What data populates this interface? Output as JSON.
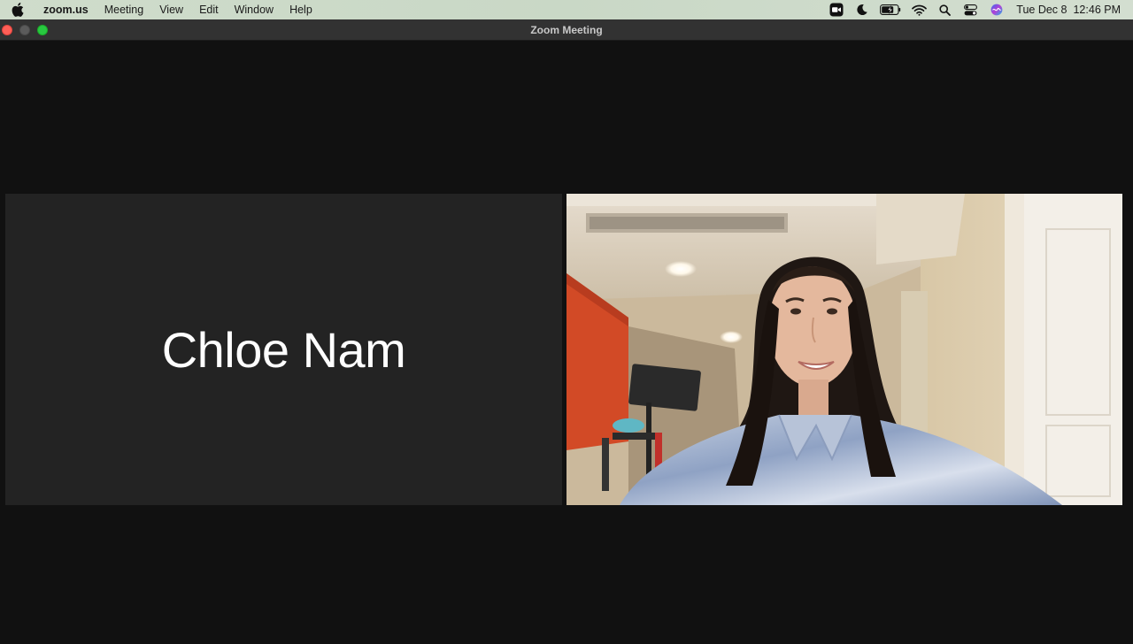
{
  "menubar": {
    "apple_icon": "apple-logo-icon",
    "app_name": "zoom.us",
    "menus": [
      "Meeting",
      "View",
      "Edit",
      "Window",
      "Help"
    ],
    "status_icons": [
      "zoom-video-icon",
      "moon-icon",
      "battery-icon",
      "wifi-icon",
      "search-icon",
      "control-center-icon",
      "siri-icon"
    ],
    "date": "Tue Dec 8",
    "time": "12:46 PM"
  },
  "window": {
    "title": "Zoom Meeting"
  },
  "meeting": {
    "participants": [
      {
        "name": "Chloe Nam",
        "video_on": false
      },
      {
        "video_on": true
      }
    ]
  },
  "colors": {
    "background": "#111111",
    "name_tile": "#232323",
    "close": "#ff5f57",
    "maximize": "#28c840"
  }
}
